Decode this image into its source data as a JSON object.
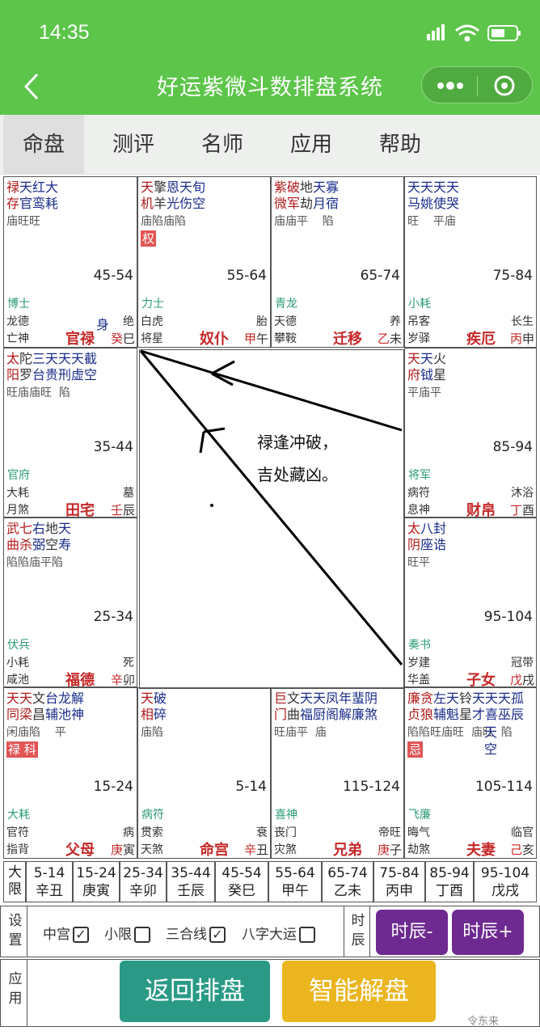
{
  "status": {
    "time": "14:35"
  },
  "nav": {
    "title": "好运紫微斗数排盘系统"
  },
  "tabs": [
    {
      "label": "命盘"
    },
    {
      "label": "测评"
    },
    {
      "label": "名师"
    },
    {
      "label": "应用"
    },
    {
      "label": "帮助"
    }
  ],
  "palaces": [
    {
      "stars": [
        {
          "t": "禄",
          "c": "major"
        },
        {
          "t": "天红大",
          "c": "minor"
        }
      ],
      "stars2": [
        {
          "t": "存",
          "c": "major"
        },
        {
          "t": "官鸾耗",
          "c": "minor"
        }
      ],
      "bright": "庙旺旺",
      "tag": "",
      "range": "45-54",
      "god": "博士",
      "l1a": "龙德",
      "l1b": "绝",
      "l2a": "亡神",
      "name": "官禄",
      "gan": "癸",
      "zhi": "巳",
      "extra": "身"
    },
    {
      "stars": [
        {
          "t": "天",
          "c": "major"
        },
        {
          "t": "擎",
          "c": "aux"
        },
        {
          "t": "恩天旬",
          "c": "minor"
        }
      ],
      "stars2": [
        {
          "t": "机",
          "c": "major"
        },
        {
          "t": "羊",
          "c": "aux"
        },
        {
          "t": "光伤空",
          "c": "minor"
        }
      ],
      "bright": "庙陷庙陷",
      "tag": "权",
      "range": "55-64",
      "god": "力士",
      "l1a": "白虎",
      "l1b": "胎",
      "l2a": "将星",
      "name": "奴仆",
      "gan": "甲",
      "zhi": "午",
      "extra": ""
    },
    {
      "stars": [
        {
          "t": "紫破",
          "c": "major"
        },
        {
          "t": "地",
          "c": "aux"
        },
        {
          "t": "天寡",
          "c": "minor"
        }
      ],
      "stars2": [
        {
          "t": "微军",
          "c": "major"
        },
        {
          "t": "劫",
          "c": "aux"
        },
        {
          "t": "月宿",
          "c": "minor"
        }
      ],
      "bright": "庙庙平    陷",
      "tag": "",
      "range": "65-74",
      "god": "青龙",
      "l1a": "天德",
      "l1b": "养",
      "l2a": "攀鞍",
      "name": "迁移",
      "gan": "乙",
      "zhi": "未",
      "extra": ""
    },
    {
      "stars": [
        {
          "t": "天天天天",
          "c": "minor"
        }
      ],
      "stars2": [
        {
          "t": "马姚使哭",
          "c": "minor"
        }
      ],
      "bright": "旺    平庙",
      "tag": "",
      "range": "75-84",
      "god": "小耗",
      "l1a": "吊客",
      "l1b": "长生",
      "l2a": "岁驿",
      "name": "疾厄",
      "gan": "丙",
      "zhi": "申",
      "extra": ""
    },
    {
      "stars": [
        {
          "t": "太",
          "c": "major"
        },
        {
          "t": "陀",
          "c": "aux"
        },
        {
          "t": "三天天天截",
          "c": "minor"
        }
      ],
      "stars2": [
        {
          "t": "阳",
          "c": "major"
        },
        {
          "t": "罗",
          "c": "aux"
        },
        {
          "t": "台贵刑虚空",
          "c": "minor"
        }
      ],
      "bright": "旺庙庙旺  陷",
      "tag": "",
      "range": "35-44",
      "god": "官府",
      "l1a": "大耗",
      "l1b": "墓",
      "l2a": "月煞",
      "name": "田宅",
      "gan": "壬",
      "zhi": "辰",
      "extra": ""
    },
    {
      "stars": [
        {
          "t": "天",
          "c": "major"
        },
        {
          "t": "天",
          "c": "minor"
        },
        {
          "t": "火",
          "c": "aux"
        }
      ],
      "stars2": [
        {
          "t": "府",
          "c": "major"
        },
        {
          "t": "钺",
          "c": "minor"
        },
        {
          "t": "星",
          "c": "aux"
        }
      ],
      "bright": "平庙平",
      "tag": "",
      "range": "85-94",
      "god": "将军",
      "l1a": "病符",
      "l1b": "沐浴",
      "l2a": "息神",
      "name": "财帛",
      "gan": "丁",
      "zhi": "酉",
      "extra": ""
    },
    {
      "stars": [
        {
          "t": "武七",
          "c": "major"
        },
        {
          "t": "右",
          "c": "minor"
        },
        {
          "t": "地",
          "c": "aux"
        },
        {
          "t": "天",
          "c": "minor"
        }
      ],
      "stars2": [
        {
          "t": "曲杀",
          "c": "major"
        },
        {
          "t": "弼",
          "c": "minor"
        },
        {
          "t": "空",
          "c": "aux"
        },
        {
          "t": "寿",
          "c": "minor"
        }
      ],
      "bright": "陷陷庙平陷",
      "tag": "",
      "range": "25-34",
      "god": "伏兵",
      "l1a": "小耗",
      "l1b": "死",
      "l2a": "咸池",
      "name": "福德",
      "gan": "辛",
      "zhi": "卯",
      "extra": ""
    },
    {
      "stars": [
        {
          "t": "太",
          "c": "major"
        },
        {
          "t": "八封",
          "c": "minor"
        }
      ],
      "stars2": [
        {
          "t": "阴",
          "c": "major"
        },
        {
          "t": "座诰",
          "c": "minor"
        }
      ],
      "bright": "旺平",
      "tag": "",
      "range": "95-104",
      "god": "奏书",
      "l1a": "岁建",
      "l1b": "冠带",
      "l2a": "华盖",
      "name": "子女",
      "gan": "戊",
      "zhi": "戌",
      "extra": ""
    },
    {
      "stars": [
        {
          "t": "天天",
          "c": "major"
        },
        {
          "t": "文",
          "c": "aux"
        },
        {
          "t": "台龙解",
          "c": "minor"
        }
      ],
      "stars2": [
        {
          "t": "同梁",
          "c": "major"
        },
        {
          "t": "昌",
          "c": "aux"
        },
        {
          "t": "辅池神",
          "c": "minor"
        }
      ],
      "bright": "闲庙陷    平",
      "tag": "禄  科",
      "range": "15-24",
      "god": "大耗",
      "l1a": "官符",
      "l1b": "病",
      "l2a": "指背",
      "name": "父母",
      "gan": "庚",
      "zhi": "寅",
      "extra": ""
    },
    {
      "stars": [
        {
          "t": "天",
          "c": "major"
        },
        {
          "t": "破",
          "c": "minor"
        }
      ],
      "stars2": [
        {
          "t": "相",
          "c": "major"
        },
        {
          "t": "碎",
          "c": "minor"
        }
      ],
      "bright": "庙陷",
      "tag": "",
      "range": "5-14",
      "god": "病符",
      "l1a": "贯索",
      "l1b": "衰",
      "l2a": "天煞",
      "name": "命宫",
      "gan": "辛",
      "zhi": "丑",
      "extra": ""
    },
    {
      "stars": [
        {
          "t": "巨",
          "c": "major"
        },
        {
          "t": "文",
          "c": "aux"
        },
        {
          "t": "天天凤年蜚阴",
          "c": "minor"
        }
      ],
      "stars2": [
        {
          "t": "门",
          "c": "major"
        },
        {
          "t": "曲",
          "c": "aux"
        },
        {
          "t": "福厨阁解廉煞",
          "c": "minor"
        }
      ],
      "bright": "旺庙平  庙",
      "tag": "",
      "range": "115-124",
      "god": "喜神",
      "l1a": "丧门",
      "l1b": "帝旺",
      "l2a": "灾煞",
      "name": "兄弟",
      "gan": "庚",
      "zhi": "子",
      "extra": ""
    },
    {
      "stars": [
        {
          "t": "廉贪",
          "c": "major"
        },
        {
          "t": "左天",
          "c": "minor"
        },
        {
          "t": "铃",
          "c": "aux"
        },
        {
          "t": "天天天孤",
          "c": "minor"
        }
      ],
      "stars2": [
        {
          "t": "贞狼",
          "c": "major"
        },
        {
          "t": "辅魁",
          "c": "minor"
        },
        {
          "t": "星",
          "c": "aux"
        },
        {
          "t": "才喜巫辰",
          "c": "minor"
        }
      ],
      "bright": "陷陷旺庙旺  庙旺  陷",
      "tag": "忌",
      "range": "105-114",
      "god": "飞廉",
      "l1a": "晦气",
      "l1b": "临官",
      "l2a": "劫煞",
      "name": "夫妻",
      "gan": "己",
      "zhi": "亥",
      "extra": "天空"
    }
  ],
  "daxian": {
    "label": "大限",
    "items": [
      {
        "r": "5-14",
        "g": "辛丑"
      },
      {
        "r": "15-24",
        "g": "庚寅"
      },
      {
        "r": "25-34",
        "g": "辛卯"
      },
      {
        "r": "35-44",
        "g": "壬辰"
      },
      {
        "r": "45-54",
        "g": "癸巳"
      },
      {
        "r": "55-64",
        "g": "甲午"
      },
      {
        "r": "65-74",
        "g": "乙未"
      },
      {
        "r": "75-84",
        "g": "丙申"
      },
      {
        "r": "85-94",
        "g": "丁酉"
      },
      {
        "r": "95-104",
        "g": "戊戌"
      }
    ]
  },
  "settings": {
    "label": "设置",
    "options": [
      {
        "label": "中宫",
        "checked": "✓"
      },
      {
        "label": "小限",
        "checked": ""
      },
      {
        "label": "三合线",
        "checked": "✓"
      },
      {
        "label": "八字大运",
        "checked": ""
      }
    ],
    "time_label": "时辰",
    "minus": "时辰-",
    "plus": "时辰+"
  },
  "apply": {
    "label": "应用",
    "back": "返回排盘",
    "smart": "智能解盘"
  },
  "annotation": "禄逢冲破，\n吉处藏凶。",
  "watermark": "令东来"
}
